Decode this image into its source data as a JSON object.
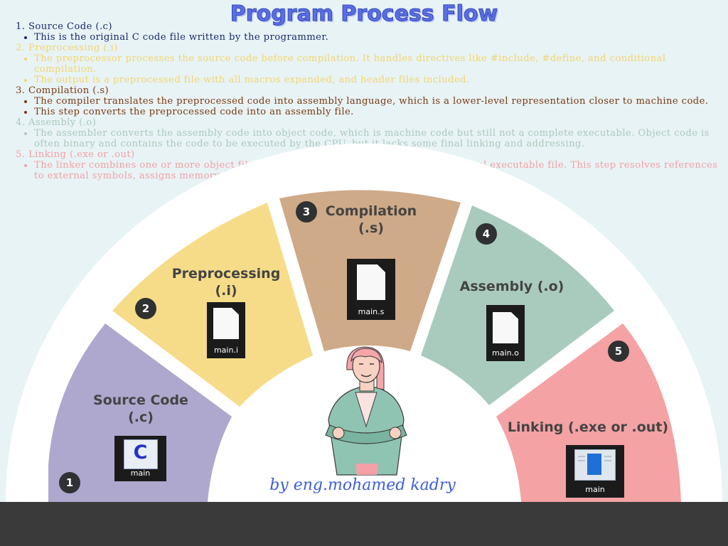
{
  "title": "Program Process Flow",
  "steps": [
    {
      "num": "1",
      "name": "Source Code (.c)",
      "head": "1. Source Code (.c)",
      "bullets": [
        "This is the original C code file written by the programmer."
      ],
      "color": "#1a2a6e"
    },
    {
      "num": "2",
      "name": "Preprocessing (.i)",
      "head": "2. Preprocessing (.i)",
      "bullets": [
        "The preprocessor processes the source code before compilation. It handles directives like #include, #define, and conditional compilation.",
        "The output is a preprocessed file with all macros expanded, and header files included."
      ],
      "color": "#f2d56e"
    },
    {
      "num": "3",
      "name": "Compilation (.s)",
      "head": "3. Compilation (.s)",
      "bullets": [
        "The compiler translates the preprocessed code into assembly language, which is a lower-level representation closer to machine code.",
        "This step converts the preprocessed code into an assembly file."
      ],
      "color": "#7a3a12"
    },
    {
      "num": "4",
      "name": "Assembly (.o)",
      "head": "4. Assembly (.o)",
      "bullets": [
        "The assembler converts the assembly code into object code, which is machine code but still not a complete executable. Object code is often binary and contains the code to be executed by the CPU, but it lacks some final linking and addressing."
      ],
      "color": "#aac9bd"
    },
    {
      "num": "5",
      "name": "Linking (.exe or .out)",
      "head": "5. Linking (.exe or .out)",
      "bullets": [
        "The linker combines one or more object files and any required libraries to produce a final executable file. This step resolves references to external symbols, assigns memory addresses, and creates the final runnable program."
      ],
      "color": "#f3a0a6"
    }
  ],
  "segments": {
    "source": {
      "label1": "Source Code",
      "label2": "(.c)",
      "file": "main",
      "icon": "c-source-file-icon",
      "color": "#aea8cf"
    },
    "preprocessing": {
      "label1": "Preprocessing",
      "label2": "(.i)",
      "file": "main.i",
      "icon": "file-icon",
      "color": "#f6dc88"
    },
    "compilation": {
      "label1": "Compilation",
      "label2": "(.s)",
      "file": "main.s",
      "icon": "file-icon",
      "color": "#cfaa88"
    },
    "assembly": {
      "label1": "Assembly (.o)",
      "file": "main.o",
      "icon": "file-icon",
      "color": "#a9cbbe"
    },
    "linking": {
      "label1": "Linking (.exe or .out)",
      "file": "main",
      "icon": "executable-file-icon",
      "color": "#f4a2a4"
    }
  },
  "byline": "by eng.mohamed kadry"
}
